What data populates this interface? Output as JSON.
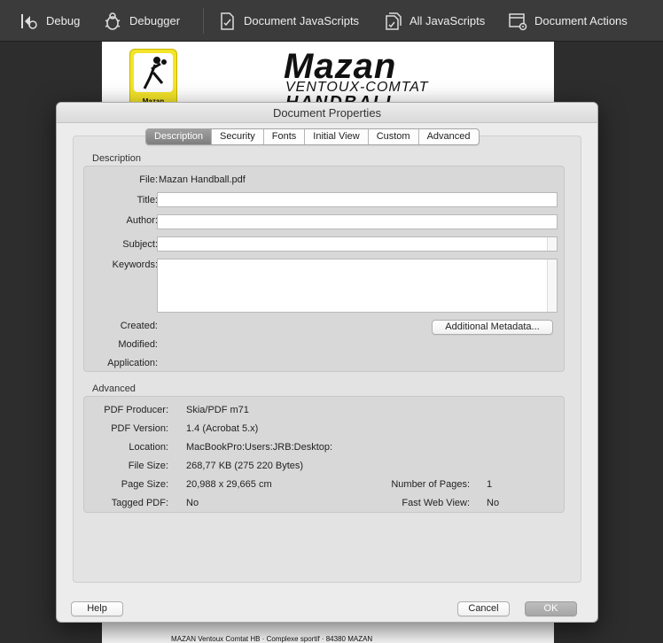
{
  "toolbar": {
    "items": [
      {
        "label": "Debug",
        "icon": "debug-step-icon"
      },
      {
        "label": "Debugger",
        "icon": "bug-icon"
      },
      {
        "label": "Document JavaScripts",
        "icon": "document-script-icon"
      },
      {
        "label": "All JavaScripts",
        "icon": "all-scripts-icon"
      },
      {
        "label": "Document Actions",
        "icon": "document-actions-icon"
      }
    ]
  },
  "pdf": {
    "brand_title": "Mazan",
    "brand_subtitle": "VENTOUX-COMTAT",
    "brand_third": "HANDBALL",
    "logo_name": "Mazan",
    "footer_text": "MAZAN Ventoux Comtat HB · Complexe sportif · 84380 MAZAN"
  },
  "dialog": {
    "title": "Document Properties",
    "tabs": [
      "Description",
      "Security",
      "Fonts",
      "Initial View",
      "Custom",
      "Advanced"
    ],
    "active_tab": "Description",
    "description": {
      "section_label": "Description",
      "file_label": "File:",
      "file_value": "Mazan Handball.pdf",
      "title_label": "Title:",
      "title_value": "",
      "author_label": "Author:",
      "author_value": "",
      "subject_label": "Subject:",
      "subject_value": "",
      "keywords_label": "Keywords:",
      "keywords_value": "",
      "created_label": "Created:",
      "modified_label": "Modified:",
      "application_label": "Application:",
      "metadata_button": "Additional Metadata..."
    },
    "advanced": {
      "section_label": "Advanced",
      "producer_label": "PDF Producer:",
      "producer_value": "Skia/PDF m71",
      "version_label": "PDF Version:",
      "version_value": "1.4 (Acrobat 5.x)",
      "location_label": "Location:",
      "location_value": "MacBookPro:Users:JRB:Desktop:",
      "filesize_label": "File Size:",
      "filesize_value": "268,77 KB (275 220 Bytes)",
      "pagesize_label": "Page Size:",
      "pagesize_value": "20,988 x 29,665 cm",
      "pages_label": "Number of Pages:",
      "pages_value": "1",
      "tagged_label": "Tagged PDF:",
      "tagged_value": "No",
      "fastweb_label": "Fast Web View:",
      "fastweb_value": "No"
    },
    "buttons": {
      "help": "Help",
      "cancel": "Cancel",
      "ok": "OK"
    }
  },
  "colors": {
    "toolbar_bg": "#3b3b3b",
    "dialog_bg": "#ececec",
    "group_bg": "#d8d8d8",
    "tab_active": "#8e8e8e",
    "logo_yellow": "#f3e42a"
  }
}
